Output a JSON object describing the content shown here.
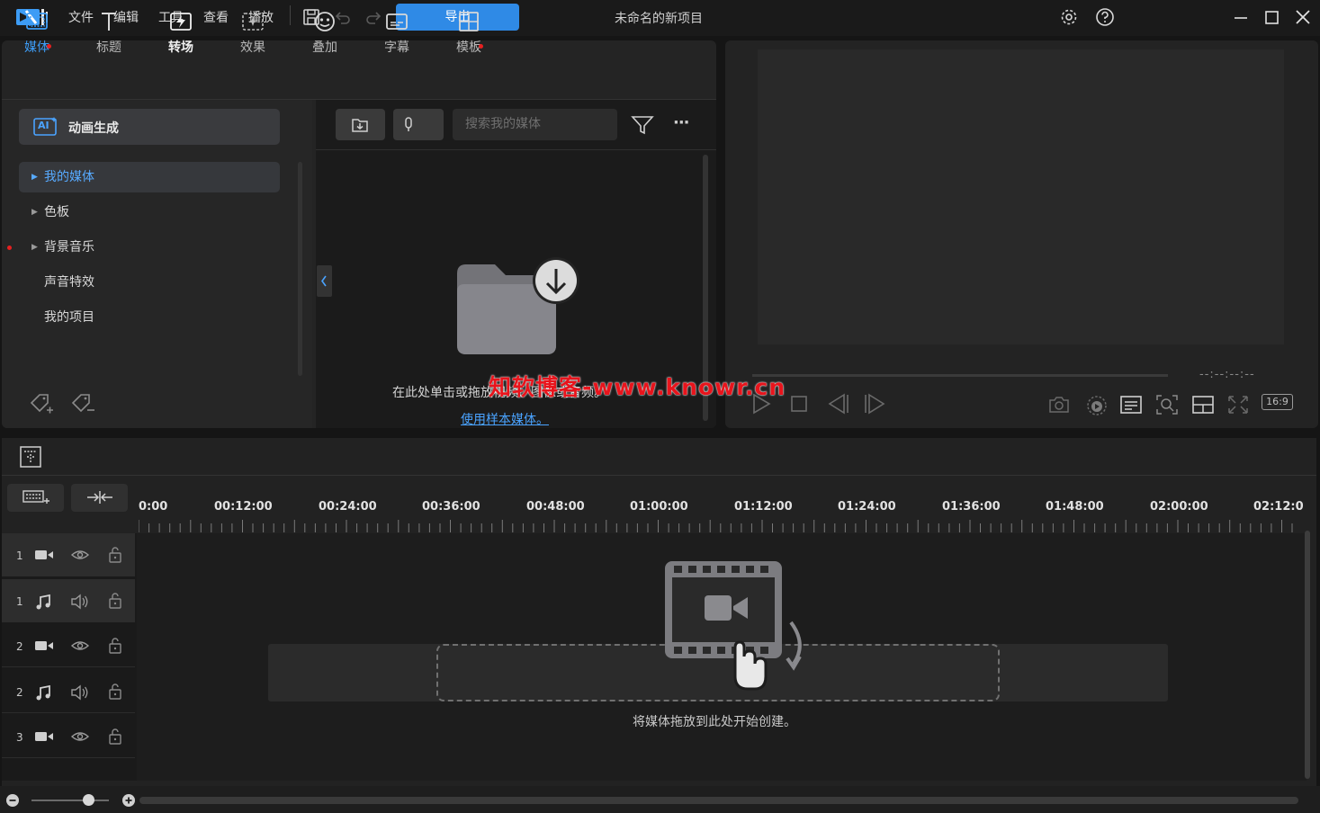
{
  "menu": [
    "文件",
    "编辑",
    "工具",
    "查看",
    "播放"
  ],
  "export_label": "导出",
  "project_title": "未命名的新项目",
  "tabs": [
    {
      "label": "媒体",
      "icon": "media-icon"
    },
    {
      "label": "标题",
      "icon": "title-icon"
    },
    {
      "label": "转场",
      "icon": "transition-icon"
    },
    {
      "label": "效果",
      "icon": "effects-icon"
    },
    {
      "label": "叠加",
      "icon": "overlay-icon"
    },
    {
      "label": "字幕",
      "icon": "subtitle-icon"
    },
    {
      "label": "模板",
      "icon": "template-icon"
    }
  ],
  "sidebar": {
    "ai_button": "动画生成",
    "ai_badge": "AI",
    "items": [
      "我的媒体",
      "色板",
      "背景音乐",
      "声音特效",
      "我的项目"
    ]
  },
  "media": {
    "search_placeholder": "搜索我的媒体",
    "empty_text": "在此处单击或拖放视频、图像或音频。",
    "sample_link": "使用样本媒体。",
    "more_label": "···"
  },
  "preview": {
    "timecode": "--:--:--:--",
    "aspect_ratio": "16:9"
  },
  "timeline": {
    "ruler_labels": [
      "0:00",
      "00:12:00",
      "00:24:00",
      "00:36:00",
      "00:48:00",
      "01:00:00",
      "01:12:00",
      "01:24:00",
      "01:36:00",
      "01:48:00",
      "02:00:00",
      "02:12:0"
    ],
    "tracks": [
      {
        "num": "1",
        "type": "video"
      },
      {
        "num": "1",
        "type": "audio"
      },
      {
        "num": "2",
        "type": "video"
      },
      {
        "num": "2",
        "type": "audio"
      },
      {
        "num": "3",
        "type": "video"
      }
    ],
    "drop_text": "将媒体拖放到此处开始创建。"
  },
  "watermark": "知软博客-www.knowr.cn",
  "colors": {
    "accent": "#2f8ae6",
    "selected_text": "#57aaff",
    "notify_dot": "#e62020"
  }
}
